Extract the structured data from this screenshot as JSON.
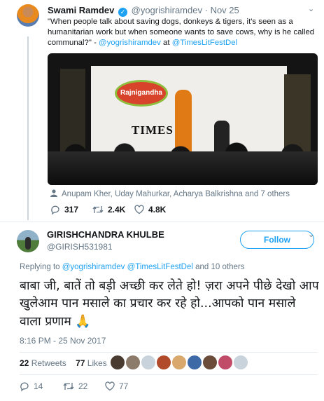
{
  "quoted_tweet": {
    "author_name": "Swami Ramdev",
    "handle": "@yogrishiramdev",
    "separator": "·",
    "date": "Nov 25",
    "text_main": "\"When people talk about saving dogs, donkeys & tigers, it's seen as a humanitarian work but when someone wants to save cows, why is he called communal?\" - ",
    "text_mention": "@yogrishiramdev",
    "text_at": " at ",
    "text_venue": "@TimesLitFestDel",
    "media": {
      "logo_text": "Rajnigandha",
      "stage_text": "TIMES"
    },
    "tagged_people": "Anupam Kher, Uday Mahurkar, Acharya Balkrishna and 7 others",
    "replies": "317",
    "retweets": "2.4K",
    "likes": "4.8K"
  },
  "reply_tweet": {
    "author_name": "GIRISHCHANDRA KHULBE",
    "handle": "@GIRISH531981",
    "follow_label": "Follow",
    "replying_prefix": "Replying to ",
    "replying_user1": "@yogrishiramdev",
    "replying_user2": "@TimesLitFestDel",
    "replying_suffix": " and 10 others",
    "text": "बाबा जी, बातें तो बड़ी अच्छी कर लेते हो! ज़रा अपने पीछे  देखो आप खुलेआम पान मसाले का प्रचार कर रहे हो...आपको पान मसाले वाला प्रणाम ",
    "emoji": "🙏",
    "timestamp": "8:16 PM - 25 Nov 2017",
    "retweets_count": "22",
    "retweets_label": "Retweets",
    "likes_count": "77",
    "likes_label": "Likes",
    "replies": "14",
    "retweets": "22",
    "likes": "77"
  },
  "colors": {
    "accent": "#1da1f2",
    "secondary_text": "#657786",
    "primary_text": "#14171a",
    "divider": "#e6ecf0"
  },
  "icons": [
    "verified-icon",
    "chevron-down-icon",
    "tag-person-icon",
    "reply-icon",
    "retweet-icon",
    "like-icon",
    "pray-emoji"
  ]
}
